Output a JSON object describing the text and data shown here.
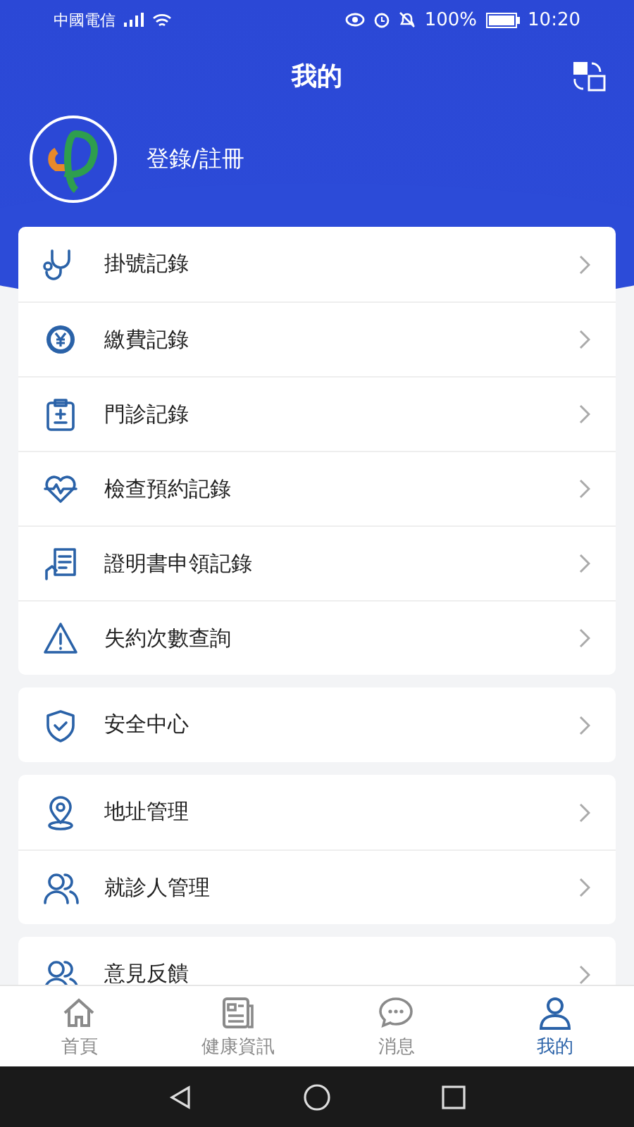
{
  "status_bar": {
    "carrier": "中國電信",
    "battery": "100%",
    "time": "10:20"
  },
  "header": {
    "title": "我的",
    "login": "登錄/註冊"
  },
  "groups": [
    {
      "items": [
        {
          "label": "掛號記錄"
        },
        {
          "label": "繳費記錄"
        },
        {
          "label": "門診記錄"
        },
        {
          "label": "檢查預約記錄"
        },
        {
          "label": "證明書申領記錄"
        },
        {
          "label": "失約次數查詢"
        }
      ]
    },
    {
      "items": [
        {
          "label": "安全中心"
        }
      ]
    },
    {
      "items": [
        {
          "label": "地址管理"
        },
        {
          "label": "就診人管理"
        }
      ]
    },
    {
      "items": [
        {
          "label": "意見反饋"
        }
      ]
    }
  ],
  "tabs": [
    {
      "label": "首頁",
      "selected": false
    },
    {
      "label": "健康資訊",
      "selected": false
    },
    {
      "label": "消息",
      "selected": false
    },
    {
      "label": "我的",
      "selected": true
    }
  ]
}
